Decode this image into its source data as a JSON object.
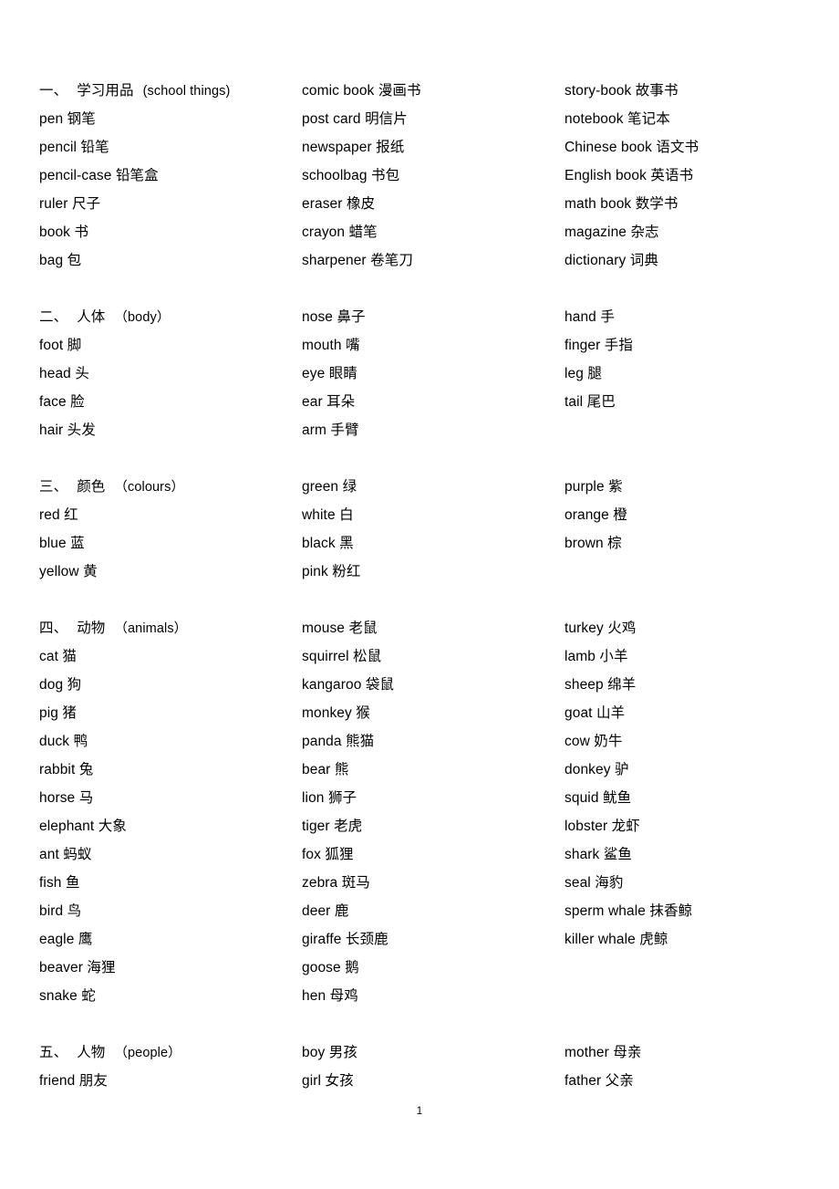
{
  "document": {
    "page_number": "1",
    "sections": [
      {
        "id": "school-things",
        "heading": {
          "index": "一、",
          "chinese": "学习用品",
          "english": "(school things)",
          "paren_style": "ascii"
        },
        "columns": [
          [
            {
              "en": "pen",
              "cn": "钢笔"
            },
            {
              "en": "pencil",
              "cn": "铅笔"
            },
            {
              "en": "pencil-case",
              "cn": "铅笔盒"
            },
            {
              "en": "ruler",
              "cn": "尺子"
            },
            {
              "en": "book",
              "cn": "书"
            },
            {
              "en": "bag",
              "cn": "包"
            }
          ],
          [
            {
              "en": "comic book",
              "cn": "漫画书"
            },
            {
              "en": "post card",
              "cn": "明信片"
            },
            {
              "en": "newspaper",
              "cn": "报纸"
            },
            {
              "en": "schoolbag",
              "cn": "书包"
            },
            {
              "en": "eraser",
              "cn": "橡皮"
            },
            {
              "en": "crayon",
              "cn": "蜡笔"
            },
            {
              "en": "sharpener",
              "cn": "卷笔刀"
            }
          ],
          [
            {
              "en": "story-book",
              "cn": "故事书"
            },
            {
              "en": "notebook",
              "cn": "笔记本"
            },
            {
              "en": "Chinese book",
              "cn": "语文书"
            },
            {
              "en": "English book",
              "cn": "英语书"
            },
            {
              "en": "math book",
              "cn": "数学书"
            },
            {
              "en": "magazine",
              "cn": "杂志"
            },
            {
              "en": "dictionary",
              "cn": "词典"
            }
          ]
        ]
      },
      {
        "id": "body",
        "heading": {
          "index": "二、",
          "chinese": "人体",
          "english": "（body）",
          "paren_style": "fullwidth"
        },
        "columns": [
          [
            {
              "en": "foot",
              "cn": "脚"
            },
            {
              "en": "head",
              "cn": "头"
            },
            {
              "en": "face",
              "cn": "脸"
            },
            {
              "en": "hair",
              "cn": "头发"
            }
          ],
          [
            {
              "en": "nose",
              "cn": "鼻子"
            },
            {
              "en": "mouth",
              "cn": "嘴"
            },
            {
              "en": "eye",
              "cn": "眼睛"
            },
            {
              "en": "ear",
              "cn": "耳朵"
            },
            {
              "en": "arm",
              "cn": "手臂"
            }
          ],
          [
            {
              "en": "hand",
              "cn": "手"
            },
            {
              "en": "finger",
              "cn": "手指"
            },
            {
              "en": "leg",
              "cn": "腿"
            },
            {
              "en": "tail",
              "cn": "尾巴"
            }
          ]
        ]
      },
      {
        "id": "colours",
        "heading": {
          "index": "三、",
          "chinese": "颜色",
          "english": "（colours）",
          "paren_style": "fullwidth"
        },
        "columns": [
          [
            {
              "en": "red",
              "cn": "红"
            },
            {
              "en": "blue",
              "cn": "蓝"
            },
            {
              "en": "yellow",
              "cn": "黄"
            }
          ],
          [
            {
              "en": "green",
              "cn": "绿"
            },
            {
              "en": "white",
              "cn": "白"
            },
            {
              "en": "black",
              "cn": "黑"
            },
            {
              "en": "pink",
              "cn": "粉红"
            }
          ],
          [
            {
              "en": "purple",
              "cn": "紫"
            },
            {
              "en": "orange",
              "cn": "橙"
            },
            {
              "en": "brown",
              "cn": "棕"
            }
          ]
        ]
      },
      {
        "id": "animals",
        "heading": {
          "index": "四、",
          "chinese": "动物",
          "english": "（animals）",
          "paren_style": "fullwidth"
        },
        "columns": [
          [
            {
              "en": "cat",
              "cn": "猫"
            },
            {
              "en": "dog",
              "cn": "狗"
            },
            {
              "en": "pig",
              "cn": "猪"
            },
            {
              "en": "duck",
              "cn": "鸭"
            },
            {
              "en": "rabbit",
              "cn": "兔"
            },
            {
              "en": "horse",
              "cn": "马"
            },
            {
              "en": "elephant",
              "cn": "大象"
            },
            {
              "en": "ant",
              "cn": "蚂蚁"
            },
            {
              "en": "fish",
              "cn": "鱼"
            },
            {
              "en": "bird",
              "cn": "鸟"
            },
            {
              "en": "eagle",
              "cn": "鹰"
            },
            {
              "en": "beaver",
              "cn": "海狸"
            },
            {
              "en": "snake",
              "cn": "蛇"
            }
          ],
          [
            {
              "en": "mouse",
              "cn": "老鼠"
            },
            {
              "en": "squirrel",
              "cn": "松鼠"
            },
            {
              "en": "kangaroo",
              "cn": "袋鼠"
            },
            {
              "en": "monkey",
              "cn": "猴"
            },
            {
              "en": "panda",
              "cn": "熊猫"
            },
            {
              "en": "bear",
              "cn": "熊"
            },
            {
              "en": "lion",
              "cn": "狮子"
            },
            {
              "en": "tiger",
              "cn": "老虎"
            },
            {
              "en": "fox",
              "cn": "狐狸"
            },
            {
              "en": "zebra",
              "cn": "斑马"
            },
            {
              "en": "deer",
              "cn": "鹿"
            },
            {
              "en": "giraffe",
              "cn": "长颈鹿"
            },
            {
              "en": "goose",
              "cn": "鹅"
            },
            {
              "en": "hen",
              "cn": "母鸡"
            }
          ],
          [
            {
              "en": "turkey",
              "cn": "火鸡"
            },
            {
              "en": "lamb",
              "cn": "小羊"
            },
            {
              "en": "sheep",
              "cn": "绵羊"
            },
            {
              "en": "goat",
              "cn": "山羊"
            },
            {
              "en": "cow",
              "cn": "奶牛"
            },
            {
              "en": "donkey",
              "cn": "驴"
            },
            {
              "en": "squid",
              "cn": "鱿鱼"
            },
            {
              "en": "lobster",
              "cn": "龙虾"
            },
            {
              "en": "shark",
              "cn": "鲨鱼"
            },
            {
              "en": "seal",
              "cn": "海豹"
            },
            {
              "en": "sperm whale",
              "cn": "抹香鲸"
            },
            {
              "en": "killer whale",
              "cn": "虎鲸"
            }
          ]
        ]
      },
      {
        "id": "people",
        "heading": {
          "index": "五、",
          "chinese": "人物",
          "english": "（people）",
          "paren_style": "fullwidth"
        },
        "columns": [
          [
            {
              "en": "friend",
              "cn": "朋友"
            }
          ],
          [
            {
              "en": "boy",
              "cn": "男孩"
            },
            {
              "en": "girl",
              "cn": "女孩"
            }
          ],
          [
            {
              "en": "mother",
              "cn": "母亲"
            },
            {
              "en": "father",
              "cn": "父亲"
            }
          ]
        ]
      }
    ]
  }
}
